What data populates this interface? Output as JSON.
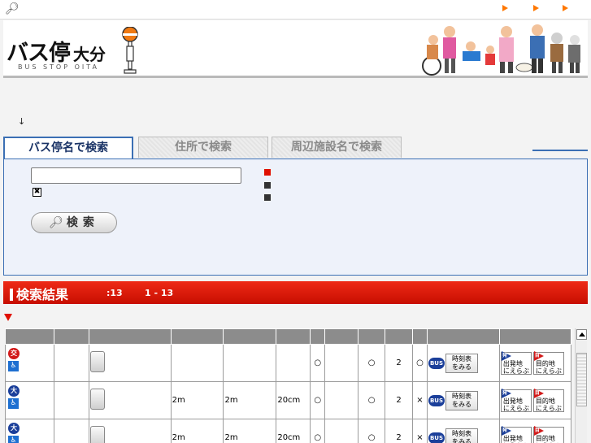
{
  "header": {
    "logo_main": "バス停",
    "logo_region": "大分",
    "logo_en": "BUS STOP OITA"
  },
  "breadcrumb_symbol": "↓",
  "tabs": [
    {
      "label": "バス停名で検索",
      "active": true
    },
    {
      "label": "住所で検索",
      "active": false
    },
    {
      "label": "周辺施設名で検索",
      "active": false
    }
  ],
  "search": {
    "value": "",
    "placeholder": "",
    "clear_mark": "✖",
    "button_label": "検索"
  },
  "results": {
    "title": "検索結果",
    "count": ":13",
    "range": "1 - 13"
  },
  "table": {
    "headers": [
      "",
      "",
      "",
      "",
      "",
      "",
      "",
      "",
      "",
      "",
      "",
      "",
      ""
    ],
    "rows": [
      {
        "type": "交",
        "badge_color": "red",
        "col4": "",
        "col5": "",
        "col6": "",
        "c7": "○",
        "c9": "○",
        "c10": "2",
        "c11": "○"
      },
      {
        "type": "大",
        "badge_color": "blue",
        "col4": "2m",
        "col5": "2m",
        "col6": "20cm",
        "c7": "○",
        "c9": "○",
        "c10": "2",
        "c11": "×"
      },
      {
        "type": "大",
        "badge_color": "blue",
        "col4": "2m",
        "col5": "2m",
        "col6": "20cm",
        "c7": "○",
        "c9": "○",
        "c10": "2",
        "c11": "×"
      }
    ],
    "bus_label": "BUS",
    "timetable_label_1": "時刻表",
    "timetable_label_2": "をみる",
    "origin_ch": "発",
    "origin_1": "出発地",
    "origin_2": "にえらぶ",
    "dest_ch": "目",
    "dest_1": "目的地",
    "dest_2": "にえらぶ"
  },
  "colors": {
    "accent_blue": "#3b6fb4",
    "result_red": "#d51200",
    "arrow_orange": "#ff7700"
  }
}
